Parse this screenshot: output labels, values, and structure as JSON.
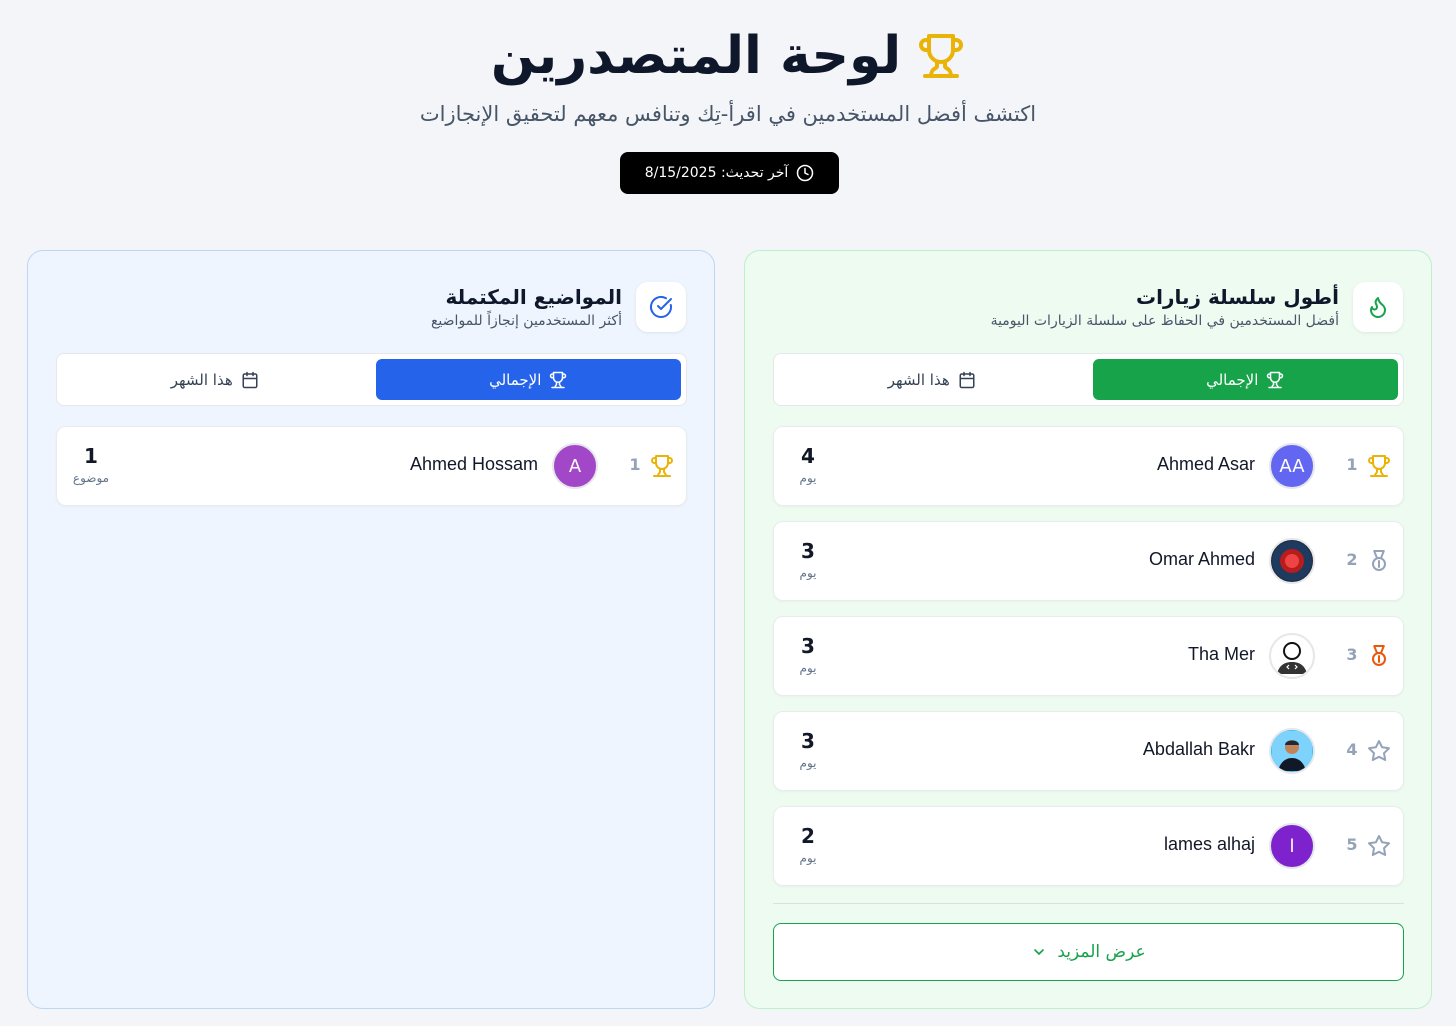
{
  "header": {
    "title": "لوحة المتصدرين",
    "subtitle": "اكتشف أفضل المستخدمين في اقرأ-تِك وتنافس معهم لتحقيق الإنجازات",
    "updated_label": "آخر تحديث: 8/15/2025"
  },
  "streak_panel": {
    "title": "أطول سلسلة زيارات",
    "subtitle": "أفضل المستخدمين في الحفاظ على سلسلة الزيارات اليومية",
    "tab_total": "الإجمالي",
    "tab_month": "هذا الشهر",
    "rows": [
      {
        "rank": "1",
        "name": "Ahmed Asar",
        "initials": "AA",
        "value": "4",
        "unit": "يوم"
      },
      {
        "rank": "2",
        "name": "Omar Ahmed",
        "initials": "",
        "value": "3",
        "unit": "يوم"
      },
      {
        "rank": "3",
        "name": "Tha Mer",
        "initials": "",
        "value": "3",
        "unit": "يوم"
      },
      {
        "rank": "4",
        "name": "Abdallah Bakr",
        "initials": "",
        "value": "3",
        "unit": "يوم"
      },
      {
        "rank": "5",
        "name": "lames alhaj",
        "initials": "l",
        "value": "2",
        "unit": "يوم"
      }
    ],
    "more_label": "عرض المزيد"
  },
  "topics_panel": {
    "title": "المواضيع المكتملة",
    "subtitle": "أكثر المستخدمين إنجازاً للمواضيع",
    "tab_total": "الإجمالي",
    "tab_month": "هذا الشهر",
    "rows": [
      {
        "rank": "1",
        "name": "Ahmed Hossam",
        "initials": "A",
        "value": "1",
        "unit": "موضوع"
      }
    ]
  },
  "colors": {
    "green": "#16a34a",
    "blue": "#2563eb",
    "gold": "#eab308",
    "silver": "#94a3b8",
    "bronze": "#ea580c"
  }
}
